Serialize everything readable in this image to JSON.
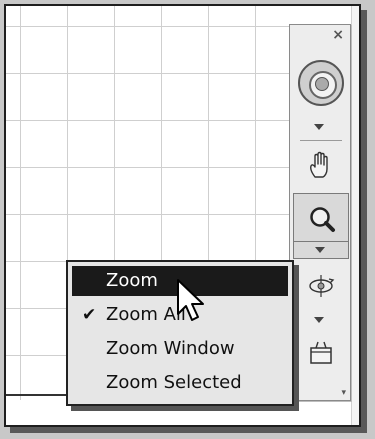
{
  "navbar": {
    "close_glyph": "×",
    "more_glyph": "▾",
    "tools": [
      "steering-wheel",
      "pan",
      "zoom",
      "orbit",
      "view-cube"
    ]
  },
  "context_menu": {
    "items": [
      {
        "label": "Zoom",
        "selected": true,
        "checked": false
      },
      {
        "label": "Zoom All",
        "selected": false,
        "checked": true
      },
      {
        "label": "Zoom Window",
        "selected": false,
        "checked": false
      },
      {
        "label": "Zoom Selected",
        "selected": false,
        "checked": false
      }
    ],
    "check_glyph": "✔"
  },
  "colors": {
    "menu_highlight": "#1a1a1a",
    "menu_background": "#e6e6e6",
    "grid": "#cfcfcf"
  }
}
